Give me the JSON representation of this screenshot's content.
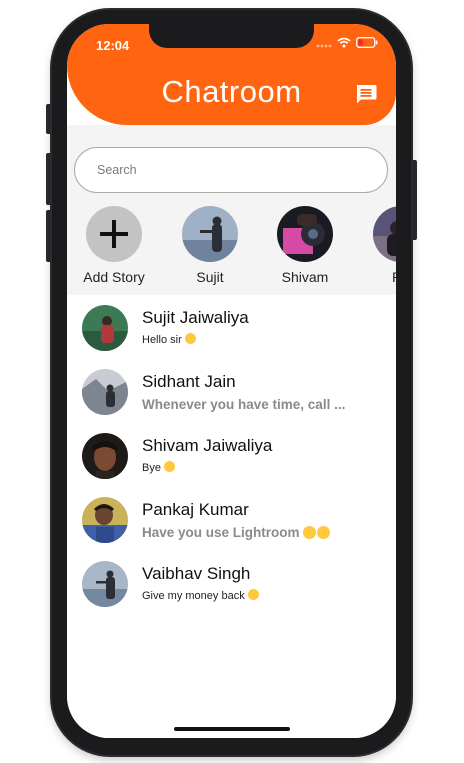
{
  "status_bar": {
    "time": "12:04"
  },
  "header": {
    "title": "Chatroom",
    "action_icon": "message-icon"
  },
  "search": {
    "placeholder": "Search"
  },
  "stories": [
    {
      "name": "Add Story",
      "type": "add"
    },
    {
      "name": "Sujit"
    },
    {
      "name": "Shivam"
    },
    {
      "name": "Ra"
    }
  ],
  "chats": [
    {
      "name": "Sujit Jaiwaliya",
      "preview": "Hello sir",
      "unread": false
    },
    {
      "name": "Sidhant Jain",
      "preview": "Whenever you have time, call ...",
      "unread": true
    },
    {
      "name": "Shivam Jaiwaliya",
      "preview": "Bye",
      "unread": false
    },
    {
      "name": "Pankaj Kumar",
      "preview": "Have you use Lightroom",
      "unread": true
    },
    {
      "name": "Vaibhav Singh",
      "preview": "Give my money back",
      "unread": false
    }
  ],
  "colors": {
    "accent": "#ff6411",
    "story_bg": "#f4f4f4"
  }
}
